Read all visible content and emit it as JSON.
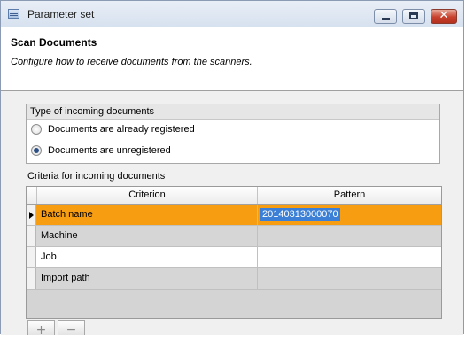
{
  "window": {
    "title": "Parameter set",
    "icon": "parameter-set-app-icon",
    "controls": {
      "minimize_icon": "minimize-icon",
      "maximize_icon": "maximize-icon",
      "close_icon": "close-icon",
      "close_glyph": "✕"
    }
  },
  "header": {
    "title": "Scan Documents",
    "subtitle": "Configure how to receive documents from the scanners."
  },
  "incoming_type": {
    "group_label": "Type of incoming documents",
    "options": [
      {
        "label": "Documents are already registered",
        "selected": false
      },
      {
        "label": "Documents are unregistered",
        "selected": true
      }
    ]
  },
  "criteria": {
    "label": "Criteria for incoming documents",
    "columns": [
      "Criterion",
      "Pattern"
    ],
    "rows": [
      {
        "criterion": "Batch name",
        "pattern": "20140313000070",
        "state": "active"
      },
      {
        "criterion": "Machine",
        "pattern": "",
        "state": "gray"
      },
      {
        "criterion": "Job",
        "pattern": "",
        "state": "white"
      },
      {
        "criterion": "Import path",
        "pattern": "",
        "state": "gray"
      }
    ],
    "active_color": "#f79d12"
  },
  "toolbar": {
    "add_glyph": "+",
    "remove_glyph": "−"
  }
}
